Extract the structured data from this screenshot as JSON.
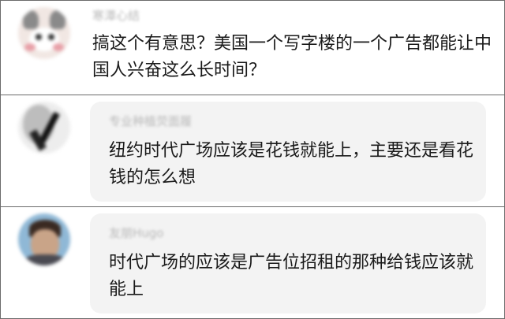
{
  "comments": [
    {
      "username": "寒潭心结",
      "text": "搞这个有意思？美国一个写字楼的一个广告都能让中国人兴奋这么长时间？"
    },
    {
      "username": "专业种植荧面履",
      "text": "纽约时代广场应该是花钱就能上，主要还是看花钱的怎么想"
    },
    {
      "username": "友朋Hugo",
      "text": "时代广场的应该是广告位招租的那种给钱应该就能上"
    }
  ],
  "colors": {
    "border": "#6b6b6b",
    "bubble": "#f3f3f3",
    "username": "#b9b9b9",
    "text": "#1a1a1a"
  }
}
